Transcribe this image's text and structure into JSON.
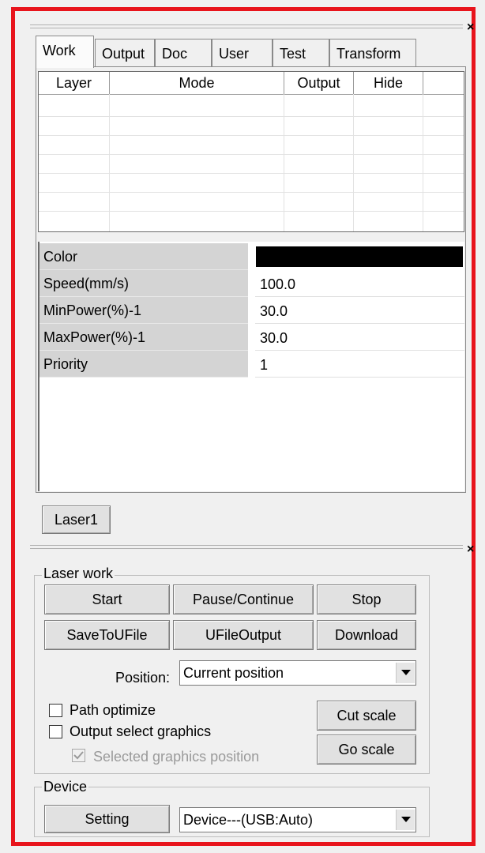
{
  "tabs": [
    "Work",
    "Output",
    "Doc",
    "User",
    "Test",
    "Transform"
  ],
  "active_tab": "Work",
  "layer_table": {
    "columns": [
      "Layer",
      "Mode",
      "Output",
      "Hide"
    ],
    "rows": []
  },
  "properties": {
    "color_label": "Color",
    "color_value": "#000000",
    "speed_label": "Speed(mm/s)",
    "speed_value": "100.0",
    "minpower_label": "MinPower(%)-1",
    "minpower_value": "30.0",
    "maxpower_label": "MaxPower(%)-1",
    "maxpower_value": "30.0",
    "priority_label": "Priority",
    "priority_value": "1"
  },
  "laser_button": "Laser1",
  "laser_work": {
    "legend": "Laser work",
    "start": "Start",
    "pause": "Pause/Continue",
    "stop": "Stop",
    "save_ufile": "SaveToUFile",
    "ufile_output": "UFileOutput",
    "download": "Download",
    "position_label": "Position:",
    "position_value": "Current position",
    "path_optimize": "Path optimize",
    "output_select": "Output select graphics",
    "selected_position": "Selected graphics position",
    "cut_scale": "Cut scale",
    "go_scale": "Go scale"
  },
  "device": {
    "legend": "Device",
    "setting": "Setting",
    "device_value": "Device---(USB:Auto)"
  },
  "close_glyph": "×",
  "colors": {
    "highlight_border": "#e8141c",
    "label_bg": "#d4d4d4"
  }
}
